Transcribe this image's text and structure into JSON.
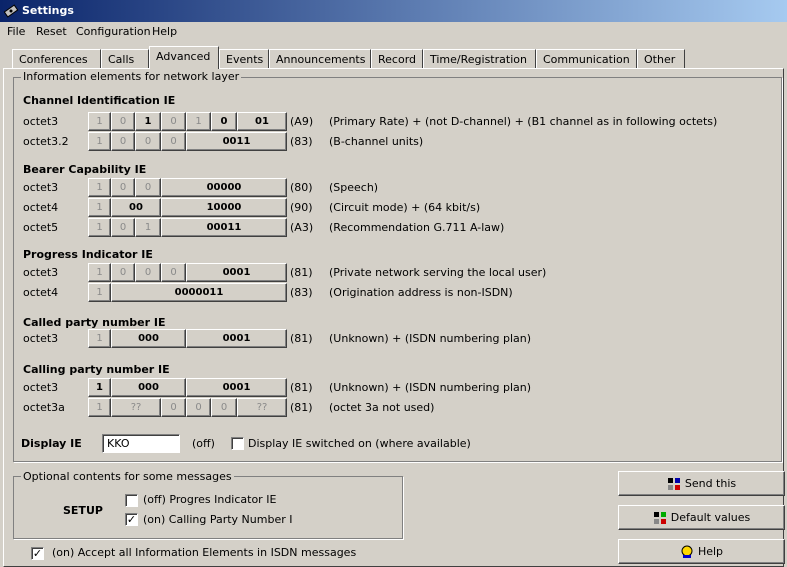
{
  "window": {
    "title": "Settings"
  },
  "menu": [
    "File",
    "Reset",
    "Configuration",
    "Help"
  ],
  "tabs": [
    "Conferences",
    "Calls",
    "Advanced",
    "Events",
    "Announcements",
    "Record",
    "Time/Registration",
    "Communication",
    "Other"
  ],
  "active_tab": "Advanced",
  "group_network": "Information elements for network layer",
  "sections": {
    "channel": "Channel Identification IE",
    "bearer": "Bearer Capability IE",
    "progress": "Progress Indicator IE",
    "called": "Called party number IE",
    "calling": "Calling party number IE"
  },
  "rows": [
    {
      "label": "octet3",
      "hex": "(A9)",
      "desc": "(Primary Rate) + (not D-channel) + (B1 channel as in following octets)",
      "cells": [
        "1",
        "0",
        "1",
        "0",
        "1",
        "0",
        "01"
      ]
    },
    {
      "label": "octet3.2",
      "hex": "(83)",
      "desc": "(B-channel units)",
      "cells": [
        "1",
        "0",
        "0",
        "0",
        "0011"
      ]
    },
    {
      "label": "octet3",
      "hex": "(80)",
      "desc": "(Speech)",
      "cells": [
        "1",
        "0",
        "0",
        "00000"
      ]
    },
    {
      "label": "octet4",
      "hex": "(90)",
      "desc": "(Circuit mode) + (64 kbit/s)",
      "cells": [
        "1",
        "00",
        "10000"
      ]
    },
    {
      "label": "octet5",
      "hex": "(A3)",
      "desc": "(Recommendation G.711 A-law)",
      "cells": [
        "1",
        "0",
        "1",
        "00011"
      ]
    },
    {
      "label": "octet3",
      "hex": "(81)",
      "desc": "(Private network serving the local user)",
      "cells": [
        "1",
        "0",
        "0",
        "0",
        "0001"
      ]
    },
    {
      "label": "octet4",
      "hex": "(83)",
      "desc": "(Origination address is non-ISDN)",
      "cells": [
        "1",
        "0000011"
      ]
    },
    {
      "label": "octet3",
      "hex": "(81)",
      "desc": "(Unknown) + (ISDN numbering plan)",
      "cells": [
        "1",
        "000",
        "0001"
      ]
    },
    {
      "label": "octet3",
      "hex": "(81)",
      "desc": "(Unknown) + (ISDN numbering plan)",
      "cells": [
        "1",
        "000",
        "0001"
      ]
    },
    {
      "label": "octet3a",
      "hex": "(81)",
      "desc": "(octet 3a not used)",
      "cells": [
        "1",
        "??",
        "0",
        "0",
        "0",
        "??"
      ]
    }
  ],
  "display": {
    "label": "Display IE",
    "value": "KKO",
    "status": "(off)",
    "checkbox_label": "Display IE switched on (where available)"
  },
  "optional": {
    "title": "Optional contents for some messages",
    "setup": "SETUP",
    "opt1": "(off) Progres Indicator IE",
    "opt2": "(on) Calling Party Number I"
  },
  "accept_all": "(on) Accept all Information Elements in ISDN messages",
  "buttons": {
    "send": "Send this",
    "defaults": "Default values",
    "help": "Help"
  }
}
